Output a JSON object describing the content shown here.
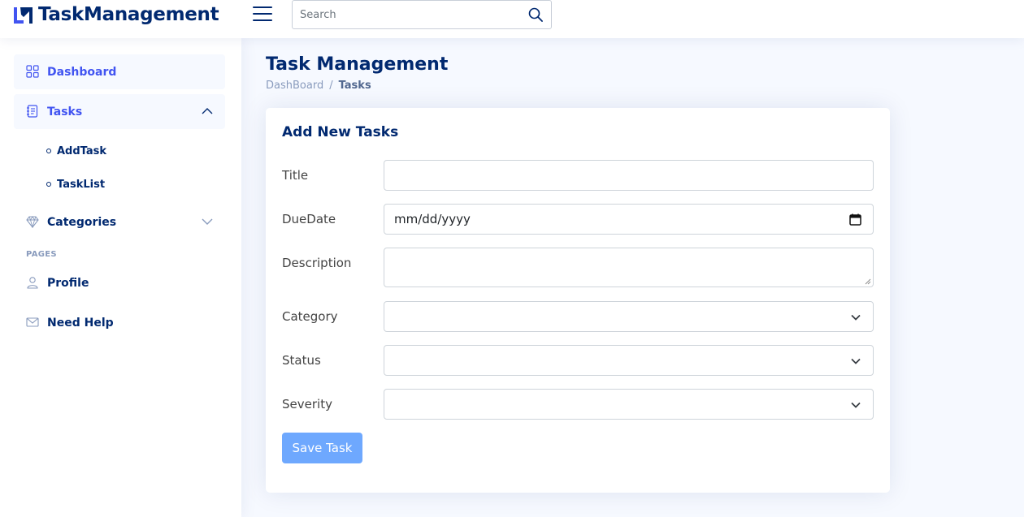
{
  "header": {
    "brand": "TaskManagement",
    "search": {
      "placeholder": "Search",
      "value": ""
    }
  },
  "sidebar": {
    "items": [
      {
        "label": "Dashboard",
        "icon": "grid-icon"
      },
      {
        "label": "Tasks",
        "icon": "journal-text-icon",
        "expanded": true,
        "children": [
          {
            "label": "AddTask"
          },
          {
            "label": "TaskList"
          }
        ]
      },
      {
        "label": "Categories",
        "icon": "gem-icon",
        "expanded": false
      }
    ],
    "section_heading": "PAGES",
    "pages": [
      {
        "label": "Profile",
        "icon": "person-icon"
      },
      {
        "label": "Need Help",
        "icon": "envelope-icon"
      }
    ]
  },
  "main": {
    "title": "Task Management",
    "breadcrumb": {
      "parent": "DashBoard",
      "separator": "/",
      "current": "Tasks"
    }
  },
  "form": {
    "title": "Add New Tasks",
    "fields": {
      "title": {
        "label": "Title",
        "value": ""
      },
      "due_date": {
        "label": "DueDate",
        "value": "mm/dd/yyyy"
      },
      "description": {
        "label": "Description",
        "value": ""
      },
      "category": {
        "label": "Category",
        "value": ""
      },
      "status": {
        "label": "Status",
        "value": ""
      },
      "severity": {
        "label": "Severity",
        "value": ""
      }
    },
    "save_label": "Save Task"
  },
  "colors": {
    "brand": "#012970",
    "accent": "#4154f1",
    "background": "#f6f9ff",
    "button": "#6ea8fe"
  }
}
